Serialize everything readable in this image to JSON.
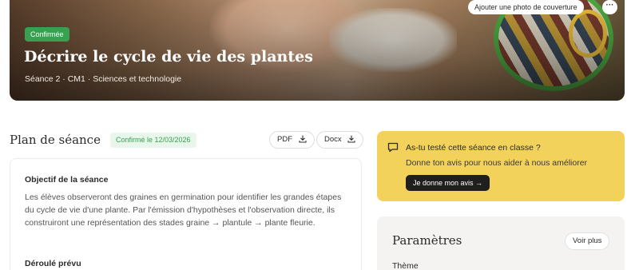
{
  "hero": {
    "status_badge": "Confirmée",
    "title": "Décrire le cycle de vie des plantes",
    "subtitle": "Séance 2 · CM1 · Sciences et technologie",
    "cover_button": "Ajouter une photo de couverture",
    "more_icon": "more-horizontal-icon"
  },
  "plan": {
    "title": "Plan de séance",
    "confirmed_tag": "Confirmé le 12/03/2026",
    "pdf_label": "PDF",
    "docx_label": "Docx",
    "download_icon": "download-icon",
    "objective_heading": "Objectif de la séance",
    "objective_text": "Les élèves observeront des graines en germination pour identifier les grandes étapes du cycle de vie d'une plante. Par l'émission d'hypothèses et l'observation directe, ils construiront une représentation des stades graine → plantule → plante fleurie.",
    "deroule_heading": "Déroulé prévu"
  },
  "feedback": {
    "icon": "message-square-icon",
    "title": "As-tu testé cette séance en classe ?",
    "subtitle": "Donne ton avis pour nous aider à nous améliorer",
    "button": "Je donne mon avis →"
  },
  "params": {
    "title": "Paramètres",
    "voir_plus": "Voir plus",
    "theme_label": "Thème"
  },
  "colors": {
    "confirmed_green": "#38a04f",
    "feedback_yellow": "#f3d25c",
    "params_bg": "#f4f3f1"
  }
}
